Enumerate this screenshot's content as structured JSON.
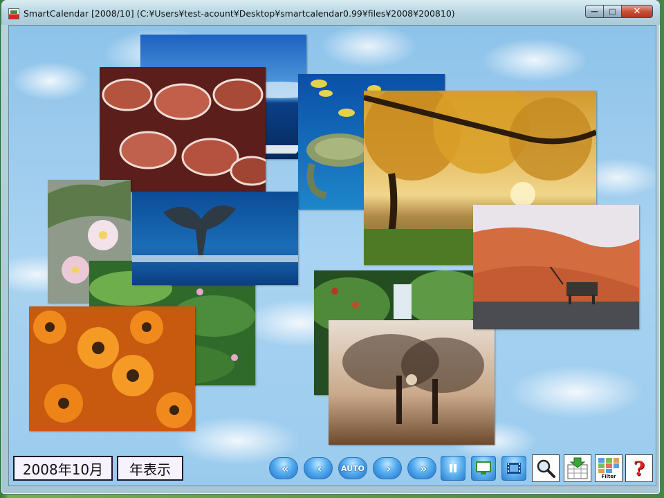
{
  "window": {
    "title": "SmartCalendar [2008/10] (C:¥Users¥test-acount¥Desktop¥smartcalendar0.99¥files¥2008¥200810)",
    "minimize_glyph": "—",
    "maximize_glyph": "□",
    "close_glyph": "✕"
  },
  "footer": {
    "month_label": "2008年10月",
    "year_view_button": "年表示"
  },
  "controls": {
    "first": "«",
    "prev": "‹",
    "auto": "AUTO",
    "next": "›",
    "last": "»",
    "filter_label": "Filter",
    "help": "?"
  },
  "photos": [
    {
      "id": "ocean-boat"
    },
    {
      "id": "fish-turtle"
    },
    {
      "id": "autumn-tree"
    },
    {
      "id": "red-leaves"
    },
    {
      "id": "plumeria"
    },
    {
      "id": "whale-tail"
    },
    {
      "id": "green-plants"
    },
    {
      "id": "orange-daisies"
    },
    {
      "id": "desert-oryx"
    },
    {
      "id": "waterfall-forest"
    },
    {
      "id": "foggy-trees"
    }
  ]
}
